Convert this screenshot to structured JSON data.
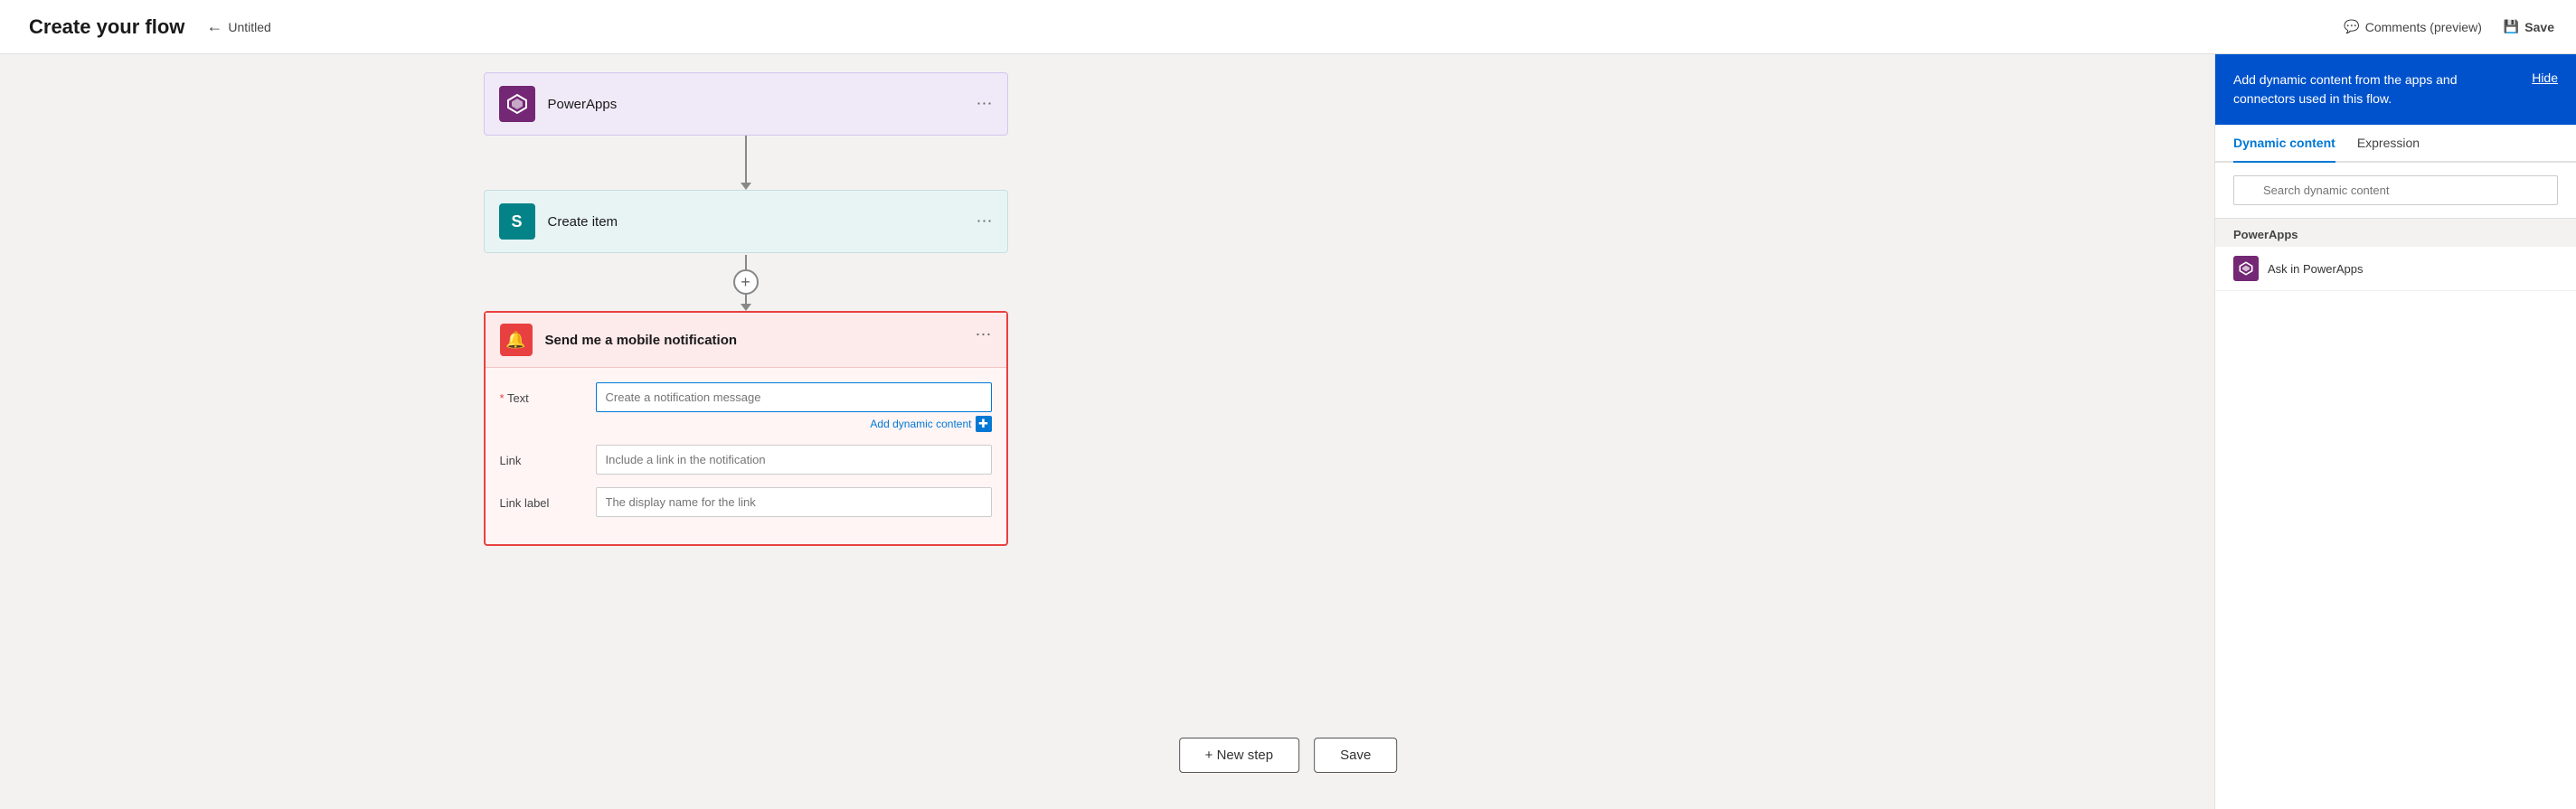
{
  "page": {
    "title": "Create your flow",
    "back_label": "Untitled"
  },
  "toolbar": {
    "comments_label": "Comments (preview)",
    "save_label": "Save"
  },
  "flow": {
    "steps": [
      {
        "id": "powerapps",
        "title": "PowerApps",
        "icon_type": "powerapps",
        "icon_text": "⬡"
      },
      {
        "id": "create-item",
        "title": "Create item",
        "icon_type": "sharepoint",
        "icon_text": "S"
      }
    ],
    "notification_step": {
      "title": "Send me a mobile notification",
      "fields": [
        {
          "id": "text",
          "label": "Text",
          "required": true,
          "placeholder": "Create a notification message",
          "add_dynamic": true,
          "add_dynamic_label": "Add dynamic content"
        },
        {
          "id": "link",
          "label": "Link",
          "required": false,
          "placeholder": "Include a link in the notification"
        },
        {
          "id": "link-label",
          "label": "Link label",
          "required": false,
          "placeholder": "The display name for the link"
        }
      ]
    }
  },
  "bottom_buttons": {
    "new_step": "+ New step",
    "save": "Save"
  },
  "dynamic_panel": {
    "header_text": "Add dynamic content from the apps and connectors used in this flow.",
    "hide_label": "Hide",
    "tabs": [
      {
        "id": "dynamic",
        "label": "Dynamic content",
        "active": true
      },
      {
        "id": "expression",
        "label": "Expression",
        "active": false
      }
    ],
    "search_placeholder": "Search dynamic content",
    "sections": [
      {
        "label": "PowerApps",
        "items": [
          {
            "id": "ask-in-powerapps",
            "label": "Ask in PowerApps",
            "icon_type": "powerapps"
          }
        ]
      }
    ]
  }
}
